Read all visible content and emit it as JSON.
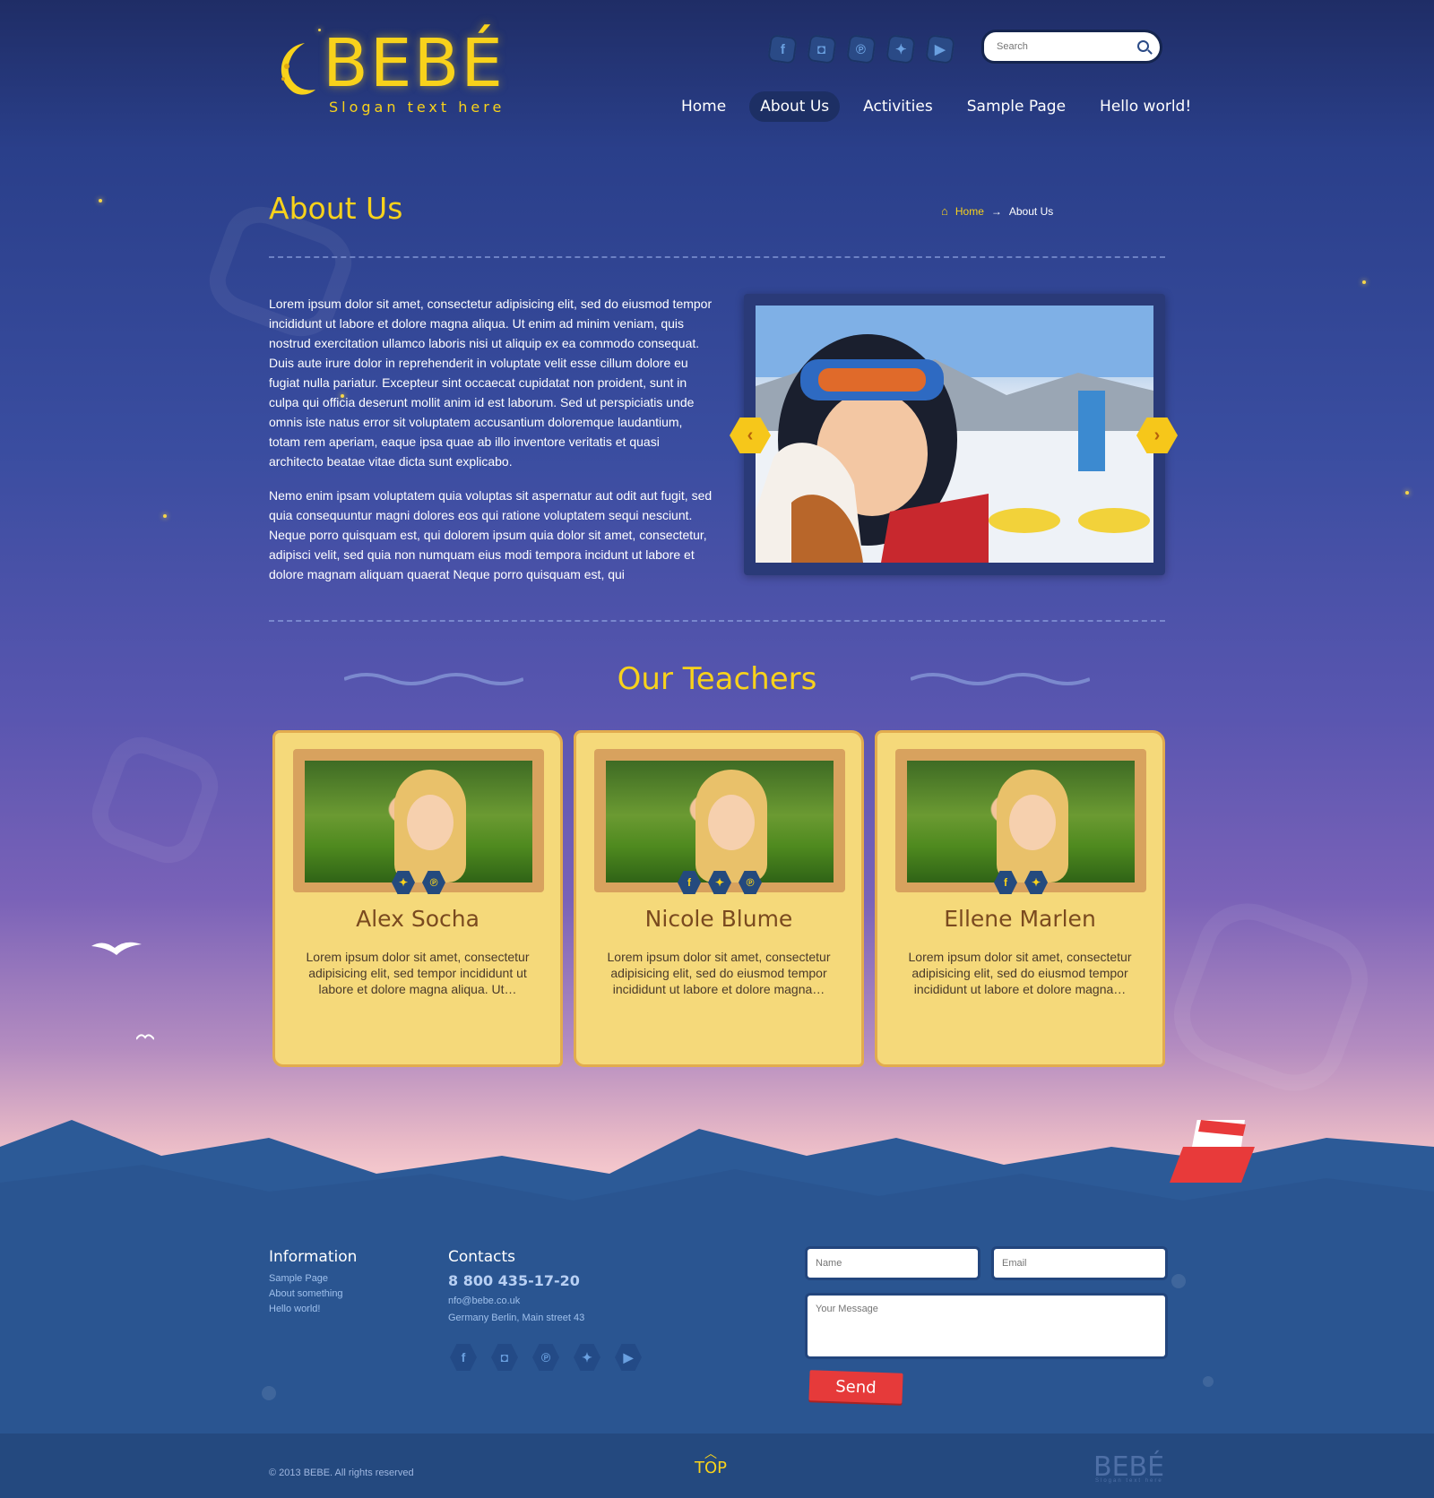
{
  "brand": {
    "name": "BEBÉ",
    "slogan": "Slogan text here"
  },
  "header": {
    "socials": [
      "facebook-icon",
      "instagram-icon",
      "pinterest-icon",
      "twitter-icon",
      "youtube-icon"
    ],
    "search_placeholder": "Search",
    "nav": [
      "Home",
      "About Us",
      "Activities",
      "Sample Page",
      "Hello world!"
    ],
    "nav_active": "About Us"
  },
  "page": {
    "title": "About Us",
    "breadcrumb": {
      "home": "Home",
      "arrow": "→",
      "current": "About Us"
    },
    "paragraphs": [
      "Lorem ipsum dolor sit amet, consectetur adipisicing elit, sed do eiusmod tempor incididunt ut labore et dolore magna aliqua. Ut enim ad minim veniam, quis nostrud exercitation ullamco laboris nisi ut aliquip ex ea commodo consequat. Duis aute irure dolor in reprehenderit in voluptate velit esse cillum dolore eu fugiat nulla pariatur. Excepteur sint occaecat cupidatat non proident, sunt in culpa qui officia deserunt mollit anim id est laborum. Sed ut perspiciatis unde omnis iste natus error sit voluptatem accusantium doloremque laudantium, totam rem aperiam, eaque ipsa quae ab illo inventore veritatis et quasi architecto beatae vitae dicta sunt explicabo.",
      "Nemo enim ipsam voluptatem quia voluptas sit aspernatur aut odit aut fugit, sed quia consequuntur magni dolores eos qui ratione voluptatem sequi nesciunt. Neque porro quisquam est, qui dolorem ipsum quia dolor sit amet, consectetur, adipisci velit, sed quia non numquam eius modi tempora incidunt ut labore et dolore magnam aliquam quaerat Neque porro quisquam est, qui"
    ],
    "slider": {
      "prev": "‹",
      "next": "›"
    }
  },
  "teachers": {
    "title": "Our Teachers",
    "items": [
      {
        "name": "Alex Socha",
        "desc": "Lorem ipsum dolor sit amet, consectetur adipisicing elit, sed tempor incididunt ut labore et dolore magna aliqua. Ut…",
        "icons": [
          "twitter-icon",
          "pinterest-icon"
        ]
      },
      {
        "name": "Nicole Blume",
        "desc": "Lorem ipsum dolor sit amet, consectetur adipisicing elit, sed do eiusmod tempor incididunt ut labore et dolore magna…",
        "icons": [
          "facebook-icon",
          "twitter-icon",
          "pinterest-icon"
        ]
      },
      {
        "name": "Ellene Marlen",
        "desc": "Lorem ipsum dolor sit amet, consectetur adipisicing elit, sed do eiusmod tempor incididunt ut labore et dolore magna…",
        "icons": [
          "facebook-icon",
          "twitter-icon"
        ]
      }
    ]
  },
  "footer": {
    "info_title": "Information",
    "info_links": [
      "Sample Page",
      "About something",
      "Hello world!"
    ],
    "contacts_title": "Contacts",
    "phone": "8 800 435-17-20",
    "email": "nfo@bebe.co.uk",
    "address": "Germany Berlin, Main street 43",
    "form": {
      "name_placeholder": "Name",
      "email_placeholder": "Email",
      "message_placeholder": "Your Message",
      "send_label": "Send"
    },
    "copyright": "© 2013 BEBE. All rights reserved",
    "top_label": "TOP",
    "logo": "BEBÉ",
    "logo_slogan": "Slogan text here"
  },
  "colors": {
    "accent": "#f8d21b",
    "nav_active_bg": "#1d2f64",
    "card_bg": "#f5d97a",
    "send": "#e63a3a",
    "sea": "#2b5a9a"
  }
}
